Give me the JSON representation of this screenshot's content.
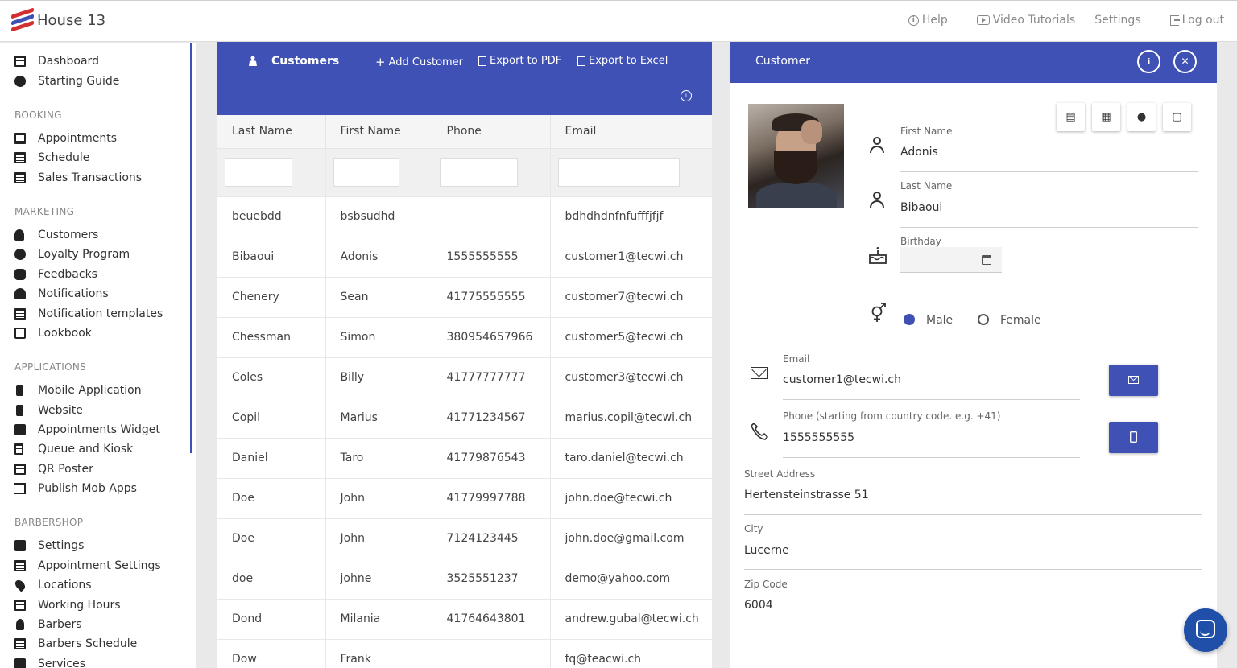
{
  "app": {
    "title": "House 13"
  },
  "topnav": {
    "help": "Help",
    "video": "Video Tutorials",
    "settings": "Settings",
    "logout": "Log out"
  },
  "sidebar": {
    "top": [
      {
        "label": "Dashboard",
        "icon": "dashboard-icon"
      },
      {
        "label": "Starting Guide",
        "icon": "info-icon"
      }
    ],
    "sections": [
      {
        "title": "BOOKING",
        "items": [
          "Appointments",
          "Schedule",
          "Sales Transactions"
        ]
      },
      {
        "title": "MARKETING",
        "items": [
          "Customers",
          "Loyalty Program",
          "Feedbacks",
          "Notifications",
          "Notification templates",
          "Lookbook"
        ]
      },
      {
        "title": "APPLICATIONS",
        "items": [
          "Mobile Application",
          "Website",
          "Appointments Widget",
          "Queue and Kiosk",
          "QR Poster",
          "Publish Mob Apps"
        ]
      },
      {
        "title": "BARBERSHOP",
        "items": [
          "Settings",
          "Appointment Settings",
          "Locations",
          "Working Hours",
          "Barbers",
          "Barbers Schedule",
          "Services"
        ]
      }
    ]
  },
  "customers": {
    "title": "Customers",
    "add": "Add Customer",
    "pdf": "Export to PDF",
    "excel": "Export to Excel",
    "columns": [
      "Last Name",
      "First Name",
      "Phone",
      "Email"
    ],
    "rows": [
      [
        "beuebdd",
        "bsbsudhd",
        "",
        "bdhdhdnfnfufffjfjf"
      ],
      [
        "Bibaoui",
        "Adonis",
        "1555555555",
        "customer1@tecwi.ch"
      ],
      [
        "Chenery",
        "Sean",
        "41775555555",
        "customer7@tecwi.ch"
      ],
      [
        "Chessman",
        "Simon",
        "380954657966",
        "customer5@tecwi.ch"
      ],
      [
        "Coles",
        "Billy",
        "41777777777",
        "customer3@tecwi.ch"
      ],
      [
        "Copil",
        "Marius",
        "41771234567",
        "marius.copil@tecwi.ch"
      ],
      [
        "Daniel",
        "Taro",
        "41779876543",
        "taro.daniel@tecwi.ch"
      ],
      [
        "Doe",
        "John",
        "41779997788",
        "john.doe@tecwi.ch"
      ],
      [
        "Doe",
        "John",
        "7124123445",
        "john.doe@gmail.com"
      ],
      [
        "doe",
        "johne",
        "3525551237",
        "demo@yahoo.com"
      ],
      [
        "Dond",
        "Milania",
        "41764643801",
        "andrew.gubal@tecwi.ch"
      ],
      [
        "Dow",
        "Frank",
        "",
        "fq@teacwi.ch"
      ]
    ]
  },
  "detail": {
    "title": "Customer",
    "first_name_label": "First Name",
    "first_name": "Adonis",
    "last_name_label": "Last Name",
    "last_name": "Bibaoui",
    "birthday_label": "Birthday",
    "male": "Male",
    "female": "Female",
    "gender": "Male",
    "email_label": "Email",
    "email": "customer1@tecwi.ch",
    "phone_label": "Phone (starting from country code. e.g. +41)",
    "phone": "1555555555",
    "street_label": "Street Address",
    "street": "Hertensteinstrasse 51",
    "city_label": "City",
    "city": "Lucerne",
    "zip_label": "Zip Code",
    "zip": "6004"
  },
  "colors": {
    "primary": "#3f51b5"
  }
}
